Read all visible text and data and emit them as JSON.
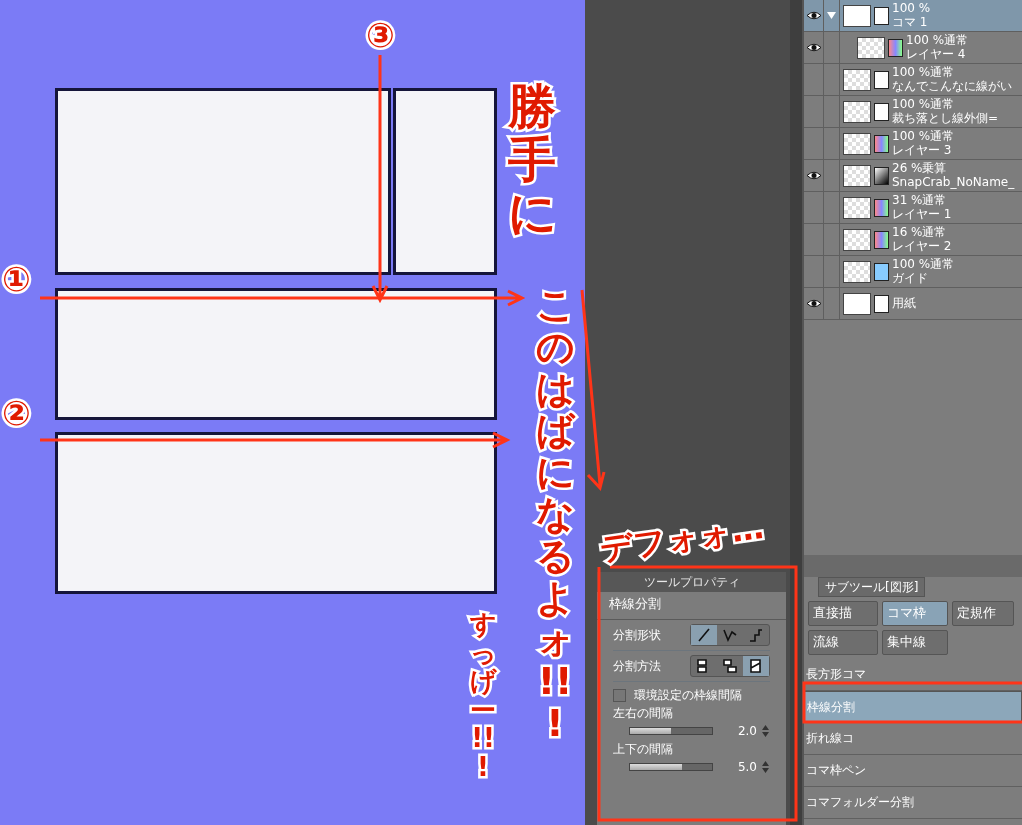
{
  "annotations": [
    {
      "kind": "circled",
      "text": "③"
    },
    {
      "kind": "circled",
      "text": "①"
    },
    {
      "kind": "circled",
      "text": "②"
    },
    {
      "kind": "vertical",
      "text": "勝手に"
    },
    {
      "kind": "vertical",
      "text": "このはばになるよォ!!!"
    },
    {
      "kind": "vertical",
      "text": "すっげー!!!"
    },
    {
      "kind": "horizontal",
      "text": "デフォォ…"
    }
  ],
  "layers": [
    {
      "kind": "folder",
      "visible": true,
      "selected": true,
      "mode": "100 %",
      "name": "コマ 1",
      "expanded": true,
      "children": [
        {
          "kind": "raster",
          "visible": true,
          "selected": false,
          "mode": "100 %通常",
          "name": "レイヤー 4"
        }
      ]
    },
    {
      "kind": "text",
      "visible": false,
      "selected": false,
      "mode": "100 %通常",
      "name": "なんでこんなに線がい"
    },
    {
      "kind": "text",
      "visible": false,
      "selected": false,
      "mode": "100 %通常",
      "name": "裁ち落とし線外側="
    },
    {
      "kind": "raster",
      "visible": false,
      "selected": false,
      "mode": "100 %通常",
      "name": "レイヤー 3"
    },
    {
      "kind": "image",
      "visible": true,
      "selected": false,
      "mode": "26 %乗算",
      "name": "SnapCrab_NoName_"
    },
    {
      "kind": "raster",
      "visible": false,
      "selected": false,
      "mode": "31 %通常",
      "name": "レイヤー 1"
    },
    {
      "kind": "raster",
      "visible": false,
      "selected": false,
      "mode": "16 %通常",
      "name": "レイヤー 2"
    },
    {
      "kind": "guide",
      "visible": false,
      "selected": false,
      "mode": "100 %通常",
      "name": "ガイド"
    },
    {
      "kind": "paper",
      "visible": true,
      "selected": false,
      "name": "用紙"
    }
  ],
  "tool_property": {
    "title": "ツールプロパティ",
    "tool": "枠線分割",
    "options": [
      {
        "label": "分割形状",
        "choices": [
          {
            "kind": "line",
            "selected": true
          },
          {
            "kind": "polyline",
            "selected": false
          },
          {
            "kind": "curve",
            "selected": false
          }
        ]
      },
      {
        "label": "分割方法",
        "choices": [
          {
            "kind": "both",
            "selected": false
          },
          {
            "kind": "one",
            "selected": false
          },
          {
            "kind": "single",
            "selected": true
          }
        ]
      }
    ],
    "checkbox": {
      "label": "環境設定の枠線間隔",
      "checked": false
    },
    "sliders": [
      {
        "label": "左右の間隔",
        "level": 0.5,
        "value": "2.0"
      },
      {
        "label": "上下の間隔",
        "level": 0.63,
        "value": "5.0"
      }
    ]
  },
  "sub_tool": {
    "tab": "サブツール[図形]",
    "groups": [
      {
        "label": "直接描",
        "selected": false
      },
      {
        "label": "コマ枠",
        "selected": true
      },
      {
        "label": "定規作",
        "selected": false
      },
      {
        "label": "流線",
        "selected": false
      },
      {
        "label": "集中線",
        "selected": false
      }
    ],
    "items": [
      {
        "label": "長方形コマ",
        "selected": false
      },
      {
        "label": "枠線分割",
        "selected": true
      },
      {
        "label": "折れ線コ",
        "selected": false
      },
      {
        "label": "コマ枠ペン",
        "selected": false
      },
      {
        "label": "コマフォルダー分割",
        "selected": false
      }
    ]
  }
}
